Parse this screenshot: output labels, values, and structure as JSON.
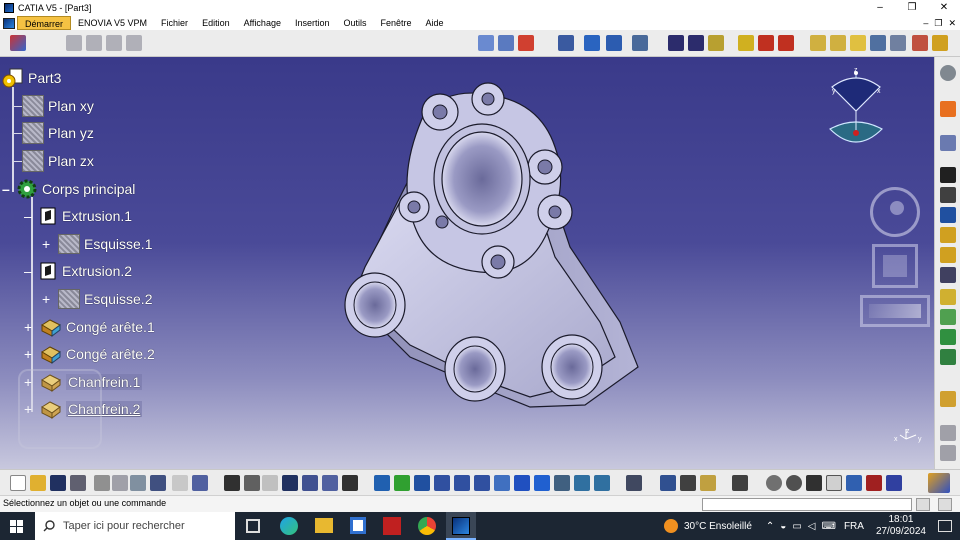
{
  "window": {
    "title": "CATIA V5 - [Part3]",
    "controls": [
      "–",
      "❐",
      "✕"
    ]
  },
  "menu": {
    "items": [
      "Démarrer",
      "ENOVIA V5 VPM",
      "Fichier",
      "Edition",
      "Affichage",
      "Insertion",
      "Outils",
      "Fenêtre",
      "Aide"
    ],
    "mdi_controls": [
      "–",
      "❐",
      "✕"
    ]
  },
  "tree": {
    "root": "Part3",
    "planes": [
      "Plan xy",
      "Plan yz",
      "Plan zx"
    ],
    "body": "Corps principal",
    "features": [
      {
        "label": "Extrusion.1",
        "child": "Esquisse.1"
      },
      {
        "label": "Extrusion.2",
        "child": "Esquisse.2"
      }
    ],
    "fillets": [
      "Congé arête.1",
      "Congé arête.2"
    ],
    "chamfers": [
      "Chanfrein.1",
      "Chanfrein.2"
    ]
  },
  "compass": {
    "axis_z": "z",
    "axis_x": "x",
    "axis_y": "y"
  },
  "axis_triad": {
    "x": "x",
    "y": "y",
    "z": "z"
  },
  "status": {
    "message": "Sélectionnez un objet ou une commande"
  },
  "taskbar": {
    "search_placeholder": "Taper ici pour rechercher",
    "weather": "30°C  Ensoleillé",
    "language": "FRA",
    "time": "18:01",
    "date": "27/09/2024"
  },
  "colors": {
    "viewport_top": "#3a3a8a",
    "viewport_bottom": "#c8c8de",
    "part": "#c6c6e4",
    "part_edge": "#1a1a2a",
    "menu_active": "#f5c243"
  }
}
